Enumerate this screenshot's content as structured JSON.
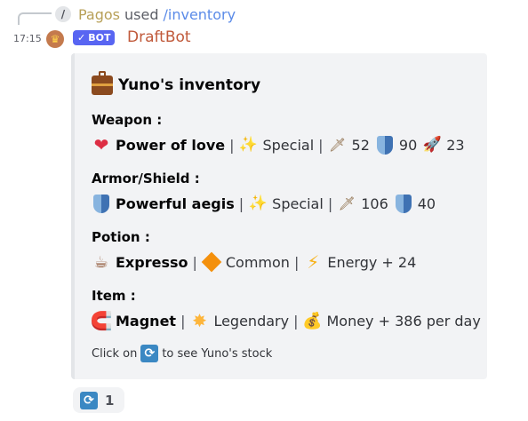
{
  "reply": {
    "slash_glyph": "/",
    "user": "Pagos",
    "used_text": "used",
    "command": "/inventory"
  },
  "message": {
    "time": "17:15",
    "bot_badge": "BOT",
    "author": "DraftBot",
    "author_color": "#c0593a"
  },
  "embed": {
    "title": "Yuno's inventory",
    "fields": [
      {
        "name": "Weapon :",
        "item": "Power of love",
        "item_icon": "heart-icon",
        "rarity": "Special",
        "attack": "52",
        "defense": "90",
        "speed": "23"
      },
      {
        "name": "Armor/Shield :",
        "item": "Powerful aegis",
        "item_icon": "shield-icon",
        "rarity": "Special",
        "attack": "106",
        "defense": "40"
      },
      {
        "name": "Potion :",
        "item": "Expresso",
        "item_icon": "coffee-icon",
        "rarity": "Common",
        "effect": "Energy + 24"
      },
      {
        "name": "Item :",
        "item": "Magnet",
        "item_icon": "magnet-icon",
        "rarity": "Legendary",
        "effect": "Money + 386 per day"
      }
    ],
    "footer": {
      "before": "Click on",
      "after": "to see Yuno's stock"
    }
  },
  "reaction": {
    "icon": "refresh-icon",
    "count": "1"
  }
}
